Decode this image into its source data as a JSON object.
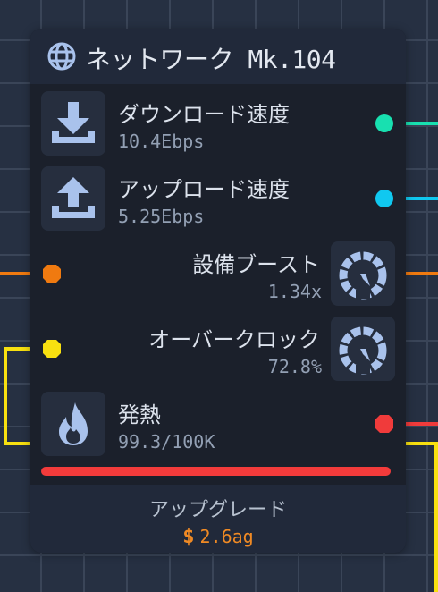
{
  "node": {
    "title": "ネットワーク Mk.104"
  },
  "rows": [
    {
      "label": "ダウンロード速度",
      "value": "10.4Ebps",
      "icon": "download-icon",
      "port_color": "#18e0b0"
    },
    {
      "label": "アップロード速度",
      "value": "5.25Ebps",
      "icon": "upload-icon",
      "port_color": "#10c8f0"
    },
    {
      "label": "設備ブースト",
      "value": "1.34x",
      "icon": "speedometer-icon",
      "port_color": "#f07a10"
    },
    {
      "label": "オーバークロック",
      "value": "72.8%",
      "icon": "speedometer-icon",
      "port_color": "#f8e010"
    },
    {
      "label": "発熱",
      "value": "99.3/100K",
      "icon": "flame-icon",
      "port_color": "#f03b3b"
    }
  ],
  "heat_fraction": 0.993,
  "upgrade": {
    "label": "アップグレード",
    "currency_symbol": "$",
    "cost": "2.6ag"
  },
  "colors": {
    "icon_blue": "#a9c2ec",
    "heat_bar": "#f33b3b",
    "price": "#f08a24"
  }
}
